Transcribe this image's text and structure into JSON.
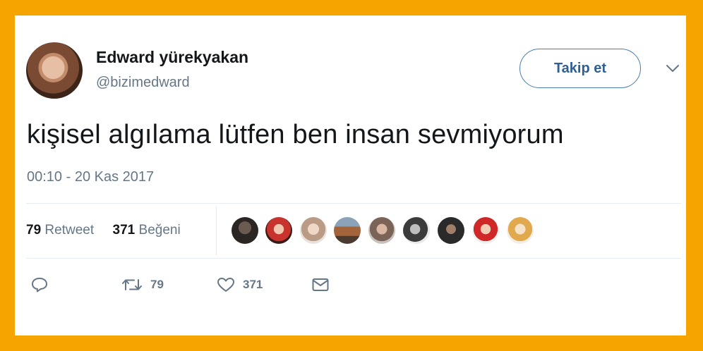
{
  "tweet": {
    "author_name": "Edward yürekyakan",
    "author_handle": "@bizimedward",
    "follow_label": "Takip et",
    "text": "kişisel algılama lütfen ben insan sevmiyorum",
    "timestamp": "00:10 - 20 Kas 2017"
  },
  "stats": {
    "retweet_count": "79",
    "retweet_label": "Retweet",
    "like_count": "371",
    "like_label": "Beğeni"
  },
  "actions": {
    "retweet_count": "79",
    "like_count": "371"
  },
  "colors": {
    "frame": "#f6a500",
    "follow_border": "#4a7cb0",
    "muted_text": "#657786"
  }
}
